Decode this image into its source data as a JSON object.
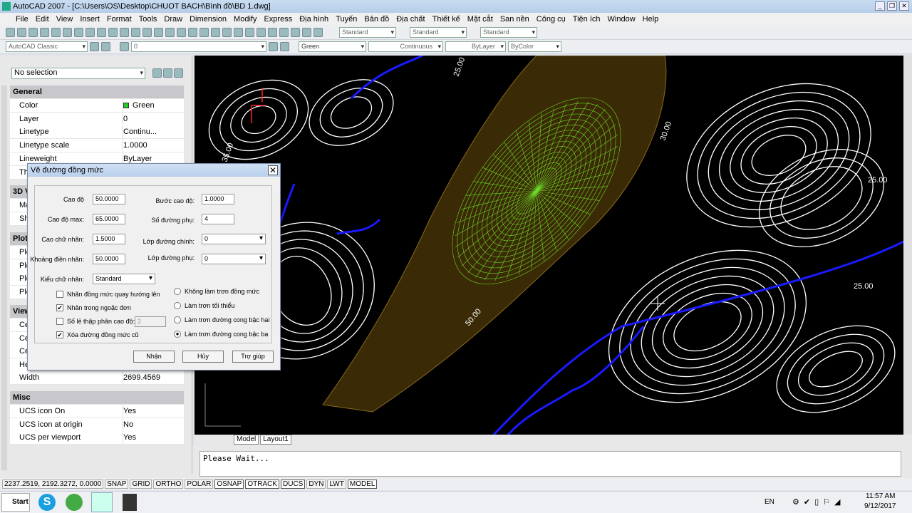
{
  "window": {
    "title": "AutoCAD 2007 - [C:\\Users\\OS\\Desktop\\CHUOT BACH\\Bình đồ\\BD 1.dwg]"
  },
  "menu": [
    "File",
    "Edit",
    "View",
    "Insert",
    "Format",
    "Tools",
    "Draw",
    "Dimension",
    "Modify",
    "Express",
    "Địa hình",
    "Tuyến",
    "Bản đồ",
    "Địa chất",
    "Thiết kế",
    "Mặt cắt",
    "San nền",
    "Công cụ",
    "Tiện ích",
    "Window",
    "Help"
  ],
  "toolbar": {
    "text_style": "Standard",
    "dim_style": "Standard",
    "table_style": "Standard",
    "workspace": "AutoCAD Classic",
    "layer": "0",
    "color": "Green",
    "linetype": "Continuous",
    "lineweight": "ByLayer",
    "plotstyle": "ByColor"
  },
  "colors": {
    "accent_green": "#22cc22",
    "contour_blue": "#1a1aff",
    "drawing_bg": "#000000"
  },
  "properties": {
    "selection": "No selection",
    "sections": {
      "general": "General",
      "view3d": "3D V",
      "plot": "Plot",
      "view": "View",
      "misc": "Misc"
    },
    "general": [
      {
        "k": "Color",
        "v": "Green"
      },
      {
        "k": "Layer",
        "v": "0"
      },
      {
        "k": "Linetype",
        "v": "Continu..."
      },
      {
        "k": "Linetype scale",
        "v": "1.0000"
      },
      {
        "k": "Lineweight",
        "v": "ByLayer"
      },
      {
        "k": "Th",
        "v": ""
      }
    ],
    "view3d": [
      "Ma",
      "Sh"
    ],
    "plot": [
      "Plc",
      "Plc",
      "Plc",
      "Plc"
    ],
    "view": [
      "Ce",
      "Ce",
      "Ce",
      "He"
    ],
    "width": {
      "k": "Width",
      "v": "2699.4569"
    },
    "misc": [
      {
        "k": "UCS icon On",
        "v": "Yes"
      },
      {
        "k": "UCS icon at origin",
        "v": "No"
      },
      {
        "k": "UCS per viewport",
        "v": "Yes"
      }
    ]
  },
  "dialog": {
    "title": "Vẽ đường đồng mức",
    "cao_do": {
      "label": "Cao độ",
      "value": "50.0000"
    },
    "cao_do_max": {
      "label": "Cao độ max:",
      "value": "65.0000"
    },
    "cao_chu_nhan": {
      "label": "Cao chữ nhãn:",
      "value": "1.5000"
    },
    "khoang_dien_nhan": {
      "label": "Khoảng điền nhãn:",
      "value": "50.0000"
    },
    "kieu_chu_nhan": {
      "label": "Kiểu chữ nhãn:",
      "value": "Standard"
    },
    "buoc_cao_do": {
      "label": "Bước cao độ:",
      "value": "1.0000"
    },
    "so_duong_phu": {
      "label": "Số đường phụ:",
      "value": "4"
    },
    "lop_duong_chinh": {
      "label": "Lớp đường chính:",
      "value": "0"
    },
    "lop_duong_phu": {
      "label": "Lớp đường phụ:",
      "value": "0"
    },
    "checks": [
      {
        "label": "Nhãn đồng mức quay hướng lên",
        "checked": false
      },
      {
        "label": "Nhãn trong ngoặc đơn",
        "checked": true
      },
      {
        "label": "Số lẻ thập phân cao độ:",
        "checked": false
      },
      {
        "label": "Xóa đường đồng mức cũ",
        "checked": true
      }
    ],
    "decimal_value": "2",
    "radios": [
      {
        "label": "Không làm trơn đồng mức",
        "selected": false
      },
      {
        "label": "Làm trơn tối thiểu",
        "selected": false
      },
      {
        "label": "Làm trơn đường cong bậc hai",
        "selected": false
      },
      {
        "label": "Làm trơn đường cong bậc ba",
        "selected": true
      }
    ],
    "ok": "Nhận",
    "cancel": "Hủy",
    "help": "Trợ giúp"
  },
  "drawing": {
    "labels": [
      "25.00",
      "30.00",
      "25.00",
      "25.00",
      "50.00",
      "35.00"
    ]
  },
  "tabs": [
    "Model",
    "Layout1"
  ],
  "command": {
    "text": "Please Wait..."
  },
  "status": {
    "coords": "2237.2519, 2192.3272, 0.0000",
    "toggles": [
      {
        "l": "SNAP",
        "on": false
      },
      {
        "l": "GRID",
        "on": false
      },
      {
        "l": "ORTHO",
        "on": false
      },
      {
        "l": "POLAR",
        "on": false
      },
      {
        "l": "OSNAP",
        "on": true
      },
      {
        "l": "OTRACK",
        "on": true
      },
      {
        "l": "DUCS",
        "on": true
      },
      {
        "l": "DYN",
        "on": false
      },
      {
        "l": "LWT",
        "on": false
      },
      {
        "l": "MODEL",
        "on": true
      }
    ]
  },
  "taskbar": {
    "start": "Start",
    "lang": "EN",
    "time": "11:57 AM",
    "date": "9/12/2017"
  }
}
